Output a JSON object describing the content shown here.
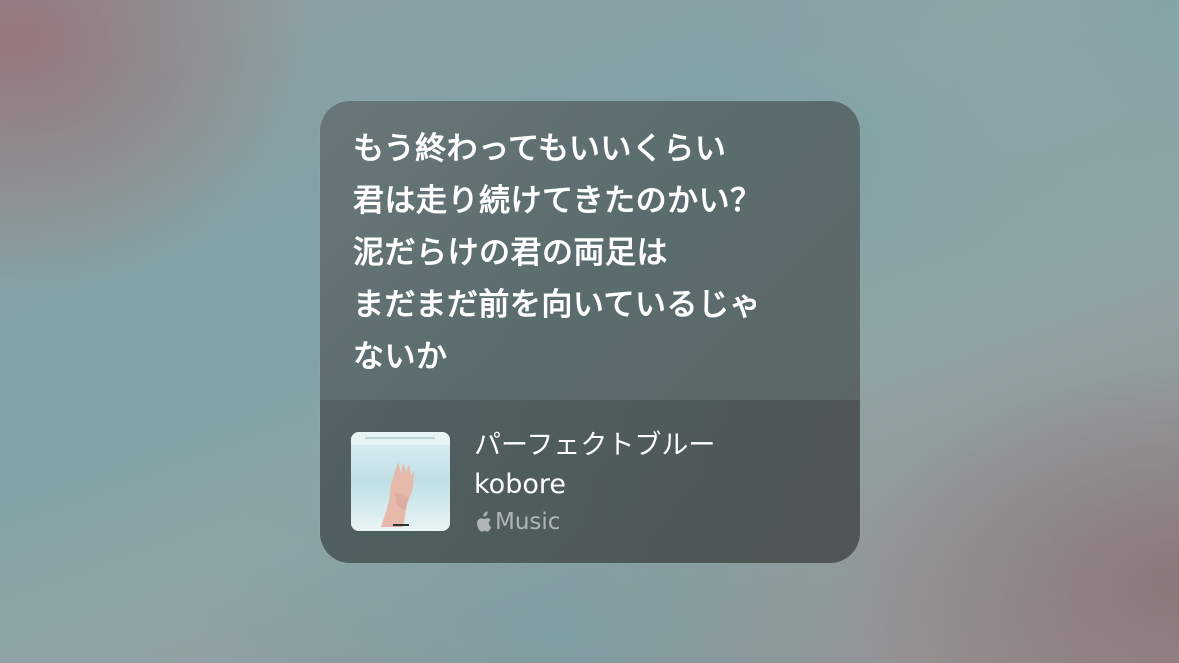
{
  "lyrics": {
    "lines": [
      "もう終わってもいいくらい",
      "君は走り続けてきたのかい？",
      "泥だらけの君の両足は",
      "まだまだ前を向いているじゃ",
      "ないか"
    ]
  },
  "song": {
    "title": "パーフェクトブルー",
    "artist": "kobore",
    "artwork_icon": "album-artwork",
    "artwork_caption": "kobore",
    "service": {
      "icon": "apple-logo-icon",
      "label": "Music"
    }
  },
  "colors": {
    "card_background": "#5e6d70",
    "text_primary": "#ffffff",
    "text_secondary": "#b4bcbd"
  }
}
